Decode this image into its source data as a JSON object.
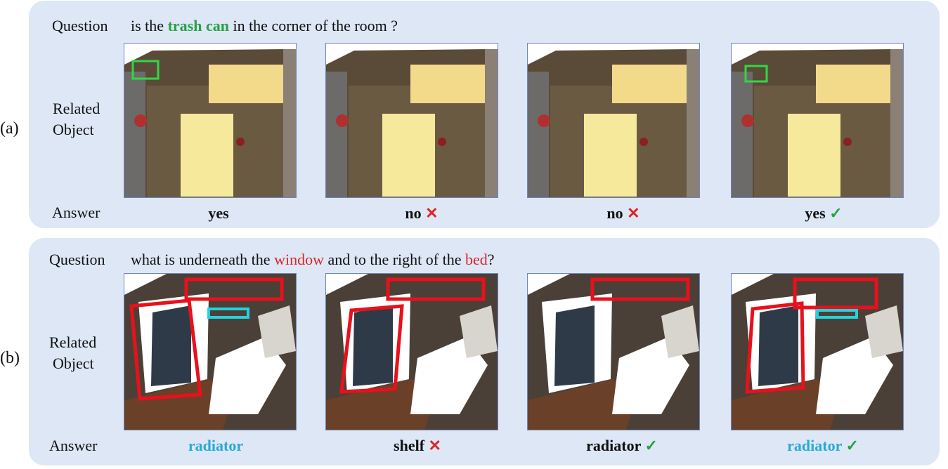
{
  "colors": {
    "panel_bg": "#dde7f5",
    "highlight_green": "#27a243",
    "highlight_red": "#e02424",
    "answer_blue": "#2aa9d6",
    "box_red": "#e8111b",
    "box_cyan": "#22d3de",
    "box_green": "#31d843"
  },
  "panel_a": {
    "label": "(a)",
    "question_label": "Question",
    "question": {
      "before": "is the",
      "highlight": "trash can",
      "after": "in the corner of the room ?"
    },
    "related_label_line1": "Related",
    "related_label_line2": "Object",
    "answer_label": "Answer",
    "answers": [
      {
        "text": "yes",
        "mark": "",
        "highlight": false
      },
      {
        "text": "no",
        "mark": "✕",
        "highlight": false
      },
      {
        "text": "no",
        "mark": "✕",
        "highlight": false
      },
      {
        "text": "yes",
        "mark": "✓",
        "highlight": false
      }
    ]
  },
  "panel_b": {
    "label": "(b)",
    "question_label": "Question",
    "question": {
      "part1": "what is underneath the",
      "highlight1": "window",
      "part2": "and to the right of the",
      "highlight2": "bed",
      "part3": "?"
    },
    "related_label_line1": "Related",
    "related_label_line2": "Object",
    "answer_label": "Answer",
    "answers": [
      {
        "text": "radiator",
        "mark": "",
        "highlight": true
      },
      {
        "text": "shelf",
        "mark": "✕",
        "highlight": false
      },
      {
        "text": "radiator",
        "mark": "✓",
        "highlight": false
      },
      {
        "text": "radiator",
        "mark": "✓",
        "highlight": true
      }
    ]
  }
}
